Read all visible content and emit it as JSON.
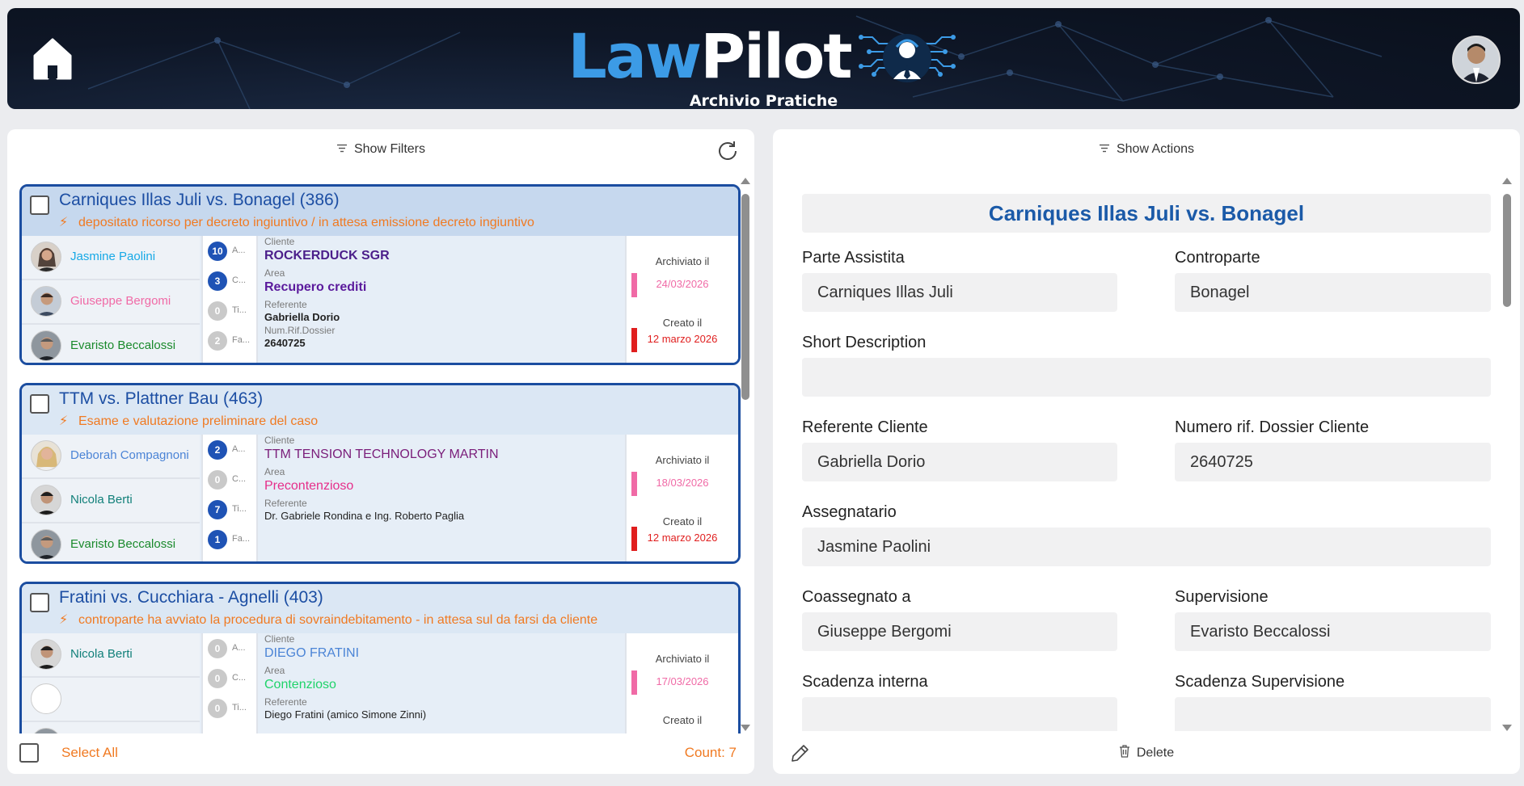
{
  "header": {
    "logo_part1": "Law",
    "logo_part2": "Pilot",
    "subtitle": "Archivio Pratiche",
    "colors": {
      "brand_blue": "#3c9be6",
      "navy": "#0e1626"
    }
  },
  "left_panel": {
    "filters_label": "Show Filters",
    "cards": [
      {
        "title": "Carniques Illas Juli vs. Bonagel (386)",
        "status": "depositato ricorso per decreto ingiuntivo / in attesa emissione decreto ingiuntivo",
        "people": [
          {
            "name": "Jasmine Paolini",
            "color": "#17a9e6"
          },
          {
            "name": "Giuseppe Bergomi",
            "color": "#f06aa6"
          },
          {
            "name": "Evaristo Beccalossi",
            "color": "#1a8a2c"
          }
        ],
        "counts": [
          {
            "n": "10",
            "label": "A...",
            "on": true
          },
          {
            "n": "3",
            "label": "C...",
            "on": true
          },
          {
            "n": "0",
            "label": "Ti...",
            "on": false
          },
          {
            "n": "2",
            "label": "Fa...",
            "on": false
          }
        ],
        "cliente_label": "Cliente",
        "cliente": "ROCKERDUCK SGR",
        "cliente_color": "#4b1e8a",
        "area_label": "Area",
        "area": "Recupero crediti",
        "area_color": "#5b1a9c",
        "referente_label": "Referente",
        "referente": "Gabriella Dorio",
        "dossier_label": "Num.Rif.Dossier",
        "dossier": "2640725",
        "archiviato_label": "Archiviato il",
        "archiviato": "24/03/2026",
        "creato_label": "Creato il",
        "creato": "12 marzo 2026"
      },
      {
        "title": "TTM vs. Plattner Bau (463)",
        "status": "Esame e valutazione preliminare del caso",
        "people": [
          {
            "name": "Deborah Compagnoni",
            "color": "#4b84d6"
          },
          {
            "name": "Nicola Berti",
            "color": "#12807a"
          },
          {
            "name": "Evaristo Beccalossi",
            "color": "#1a8a2c"
          }
        ],
        "counts": [
          {
            "n": "2",
            "label": "A...",
            "on": true
          },
          {
            "n": "0",
            "label": "C...",
            "on": false
          },
          {
            "n": "7",
            "label": "Ti...",
            "on": true
          },
          {
            "n": "1",
            "label": "Fa...",
            "on": true
          }
        ],
        "cliente_label": "Cliente",
        "cliente": "TTM TENSION TECHNOLOGY MARTIN",
        "cliente_color": "#7a1d7a",
        "area_label": "Area",
        "area": "Precontenzioso",
        "area_color": "#e62e8a",
        "referente_label": "Referente",
        "referente": "Dr. Gabriele Rondina e Ing. Roberto Paglia",
        "dossier_label": "",
        "dossier": "",
        "archiviato_label": "Archiviato il",
        "archiviato": "18/03/2026",
        "creato_label": "Creato il",
        "creato": "12 marzo 2026"
      },
      {
        "title": "Fratini vs. Cucchiara - Agnelli (403)",
        "status": "controparte ha avviato la procedura di sovraindebitamento - in attesa sul da farsi da cliente",
        "people": [
          {
            "name": "Nicola Berti",
            "color": "#12807a"
          },
          {
            "name": "",
            "color": "#333333"
          },
          {
            "name": "",
            "color": "#333333"
          }
        ],
        "counts": [
          {
            "n": "0",
            "label": "A...",
            "on": false
          },
          {
            "n": "0",
            "label": "C...",
            "on": false
          },
          {
            "n": "0",
            "label": "Ti...",
            "on": false
          },
          {
            "n": "",
            "label": "",
            "on": false
          }
        ],
        "cliente_label": "Cliente",
        "cliente": "DIEGO FRATINI",
        "cliente_color": "#4b84d6",
        "area_label": "Area",
        "area": "Contenzioso",
        "area_color": "#1fd36a",
        "referente_label": "Referente",
        "referente": "Diego Fratini (amico Simone Zinni)",
        "dossier_label": "",
        "dossier": "",
        "archiviato_label": "Archiviato il",
        "archiviato": "17/03/2026",
        "creato_label": "Creato il",
        "creato": ""
      }
    ],
    "select_all_label": "Select All",
    "count_label": "Count: 7"
  },
  "right_panel": {
    "actions_label": "Show Actions",
    "title": "Carniques Illas Juli vs. Bonagel",
    "fields": {
      "parte_assistita_label": "Parte Assistita",
      "parte_assistita": "Carniques Illas Juli",
      "controparte_label": "Controparte",
      "controparte": "Bonagel",
      "short_description_label": "Short Description",
      "short_description": "",
      "referente_cliente_label": "Referente Cliente",
      "referente_cliente": "Gabriella Dorio",
      "numero_dossier_label": "Numero rif. Dossier Cliente",
      "numero_dossier": "2640725",
      "assegnatario_label": "Assegnatario",
      "assegnatario": "Jasmine Paolini",
      "coassegnato_label": "Coassegnato a",
      "coassegnato": "Giuseppe Bergomi",
      "supervisione_label": "Supervisione",
      "supervisione": "Evaristo Beccalossi",
      "scadenza_interna_label": "Scadenza interna",
      "scadenza_supervisione_label": "Scadenza Supervisione"
    },
    "delete_label": "Delete"
  }
}
